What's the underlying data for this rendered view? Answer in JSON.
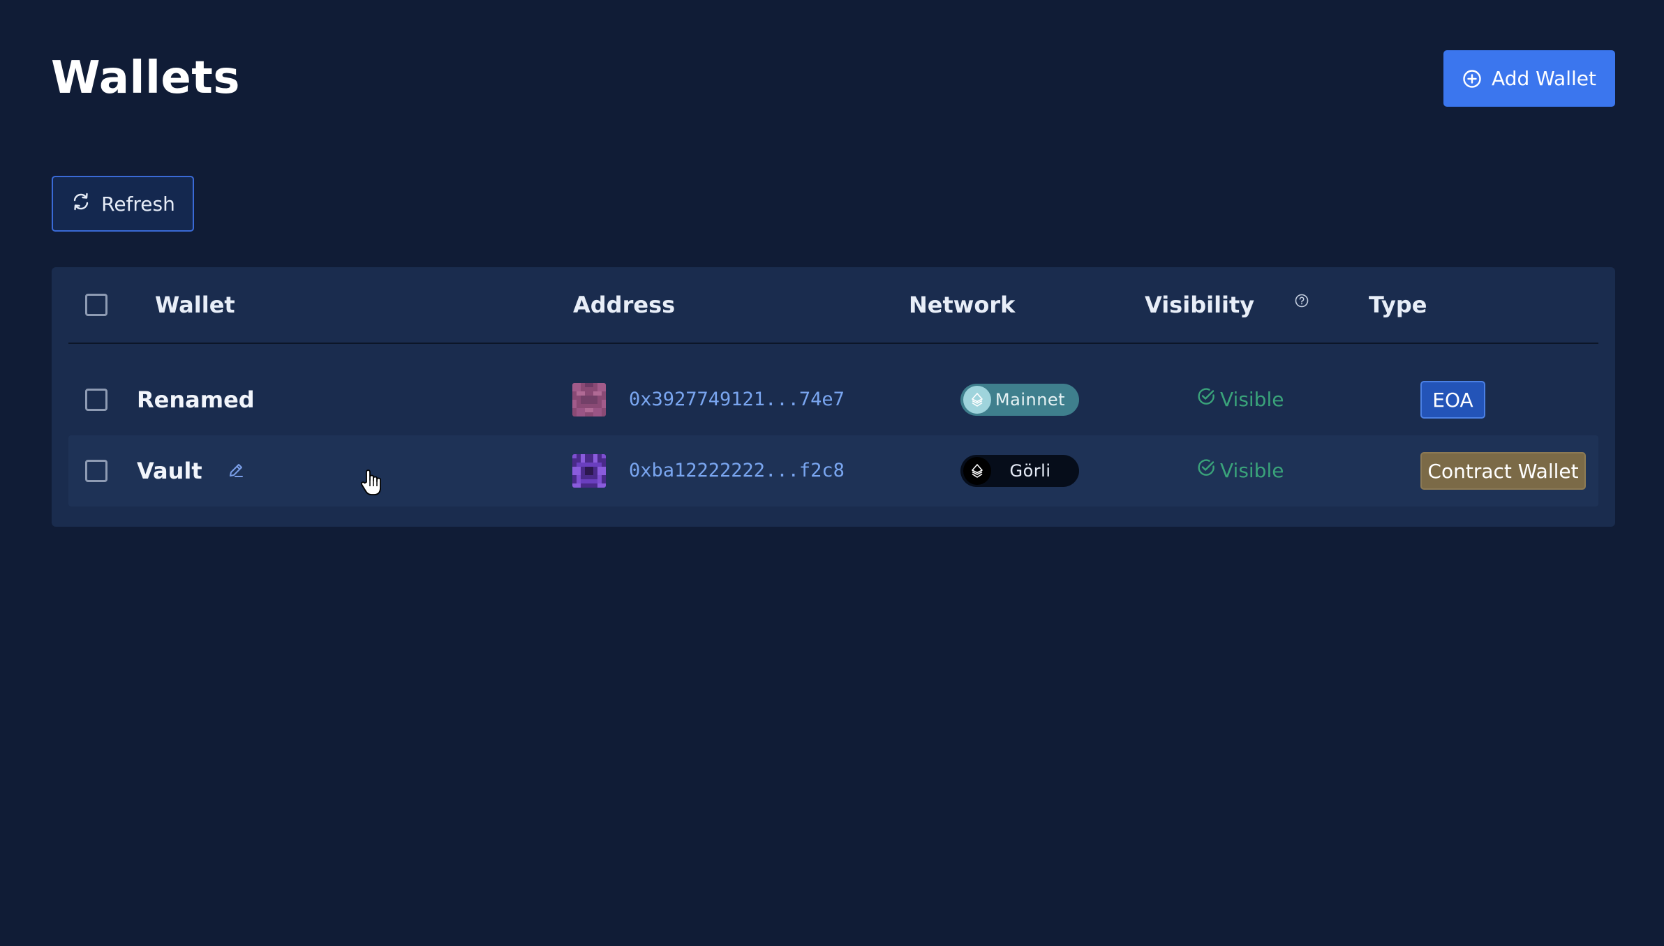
{
  "page": {
    "title": "Wallets"
  },
  "header": {
    "add_wallet_label": "Add Wallet"
  },
  "toolbar": {
    "refresh_label": "Refresh"
  },
  "table": {
    "columns": {
      "wallet": "Wallet",
      "address": "Address",
      "network": "Network",
      "visibility": "Visibility",
      "type": "Type"
    },
    "rows": [
      {
        "name": "Renamed",
        "address": "0x3927749121...74e7",
        "network": "Mainnet",
        "visibility": "Visible",
        "type": "EOA"
      },
      {
        "name": "Vault",
        "address": "0xba12222222...f2c8",
        "network": "Görli",
        "visibility": "Visible",
        "type": "Contract Wallet"
      }
    ]
  },
  "icons": {
    "add": "plus-circle-icon",
    "refresh": "refresh-icon",
    "help": "question-circle-icon",
    "edit": "pencil-icon",
    "visible": "check-circle-icon",
    "network": "ethereum-icon"
  },
  "colors": {
    "background": "#101c36",
    "panel": "#1a2c4e",
    "accent": "#3b76ee",
    "address": "#7aa6f0",
    "visible": "#3aa37a",
    "eoa_badge": "#2354b8",
    "contract_badge": "#7b6a47",
    "mainnet_pill": "#3f7f8d",
    "gorli_pill": "#060d1a"
  }
}
